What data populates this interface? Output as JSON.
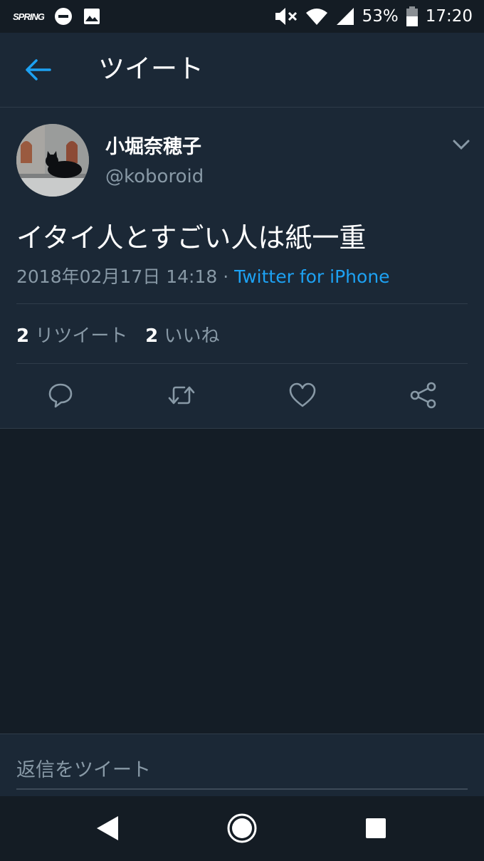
{
  "status_bar": {
    "carrier_logo": "SPRING",
    "icons_left": [
      "carrier-logo",
      "dnd-icon",
      "image-icon"
    ],
    "icons_right": [
      "mute-icon",
      "wifi-icon",
      "signal-icon",
      "battery-icon"
    ],
    "battery_percent": "53%",
    "time": "17:20"
  },
  "app_bar": {
    "title": "ツイート"
  },
  "tweet": {
    "display_name": "小堀奈穂子",
    "handle": "@koboroid",
    "text": "イタイ人とすごい人は紙一重",
    "timestamp": "2018年02月17日 14:18",
    "separator": " · ",
    "source": "Twitter for iPhone",
    "retweet_count": "2",
    "retweet_label": "リツイート",
    "like_count": "2",
    "like_label": "いいね"
  },
  "reply": {
    "placeholder": "返信をツイート"
  },
  "colors": {
    "background": "#141d26",
    "surface": "#1b2836",
    "accent": "#1da1f2",
    "secondary_text": "#8899a6"
  }
}
